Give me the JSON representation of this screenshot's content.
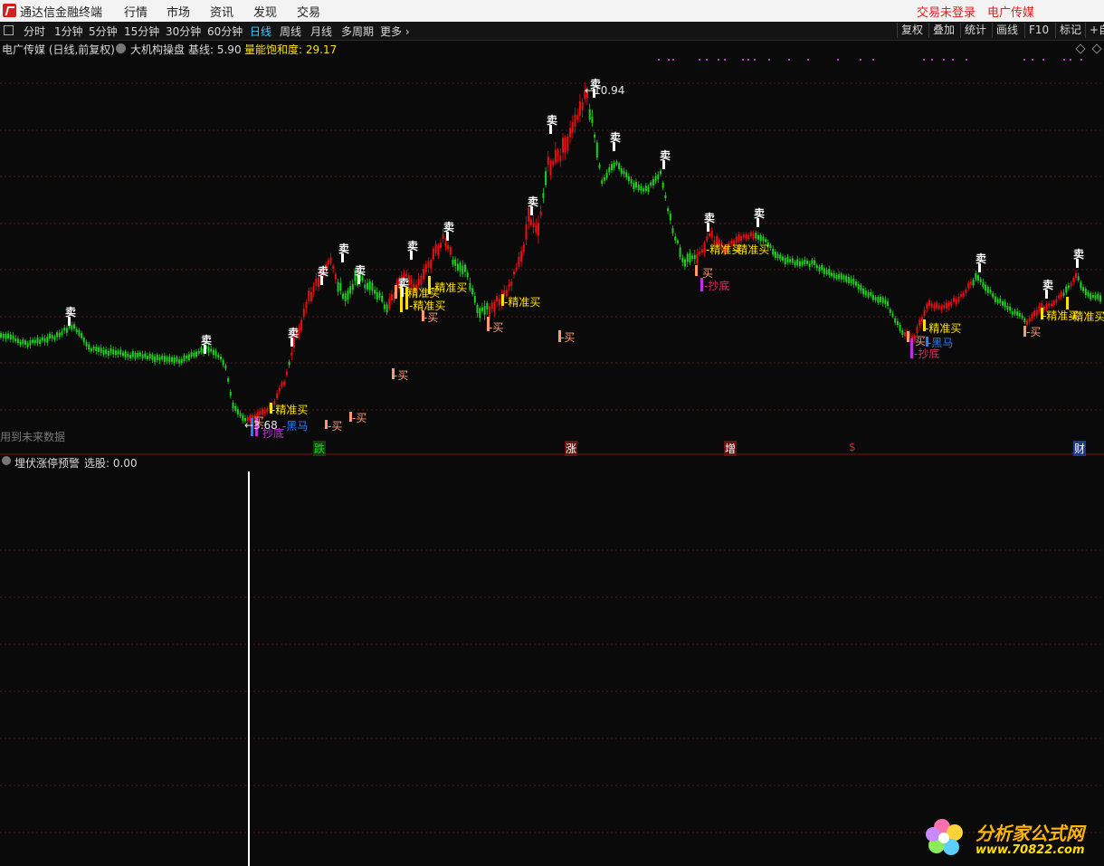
{
  "titlebar": {
    "app_name": "通达信金融终端",
    "menus": [
      "行情",
      "市场",
      "资讯",
      "发现",
      "交易"
    ],
    "login_status": "交易未登录",
    "stock_name": "电广传媒"
  },
  "toolbar": {
    "periods": [
      "分时",
      "1分钟",
      "5分钟",
      "15分钟",
      "30分钟",
      "60分钟",
      "日线",
      "周线",
      "月线",
      "多周期",
      "更多 ›"
    ],
    "active_period": "日线",
    "right_buttons": [
      "复权",
      "叠加",
      "统计",
      "画线",
      "F10",
      "标记",
      "+自"
    ]
  },
  "main_chart": {
    "title": "电广传媒 (日线,前复权)",
    "indicator_name": "大机构操盘",
    "baseline_label": "基线: 5.90",
    "saturation_label": "量能饱和度: 29.17",
    "high_price": "10.94",
    "low_price": "3.68",
    "footnote": "用到未来数据",
    "colors": {
      "up": "#e81010",
      "down": "#1ecf1e",
      "buy_precise": "#ffe000",
      "buy": "#ff9a70",
      "dark_horse": "#2a7bff",
      "bottom": "#c030e0",
      "sell": "#ffffff"
    },
    "sell_marks": [
      "卖",
      "卖",
      "卖",
      "卖",
      "卖",
      "卖",
      "卖",
      "卖",
      "卖",
      "卖",
      "卖",
      "卖",
      "卖",
      "卖",
      "卖",
      "卖",
      "卖",
      "卖",
      "卖"
    ],
    "signals": {
      "precise_buy": "-精准买",
      "buy": "-买",
      "buy_plain": "买",
      "dark_horse": "-黑马",
      "bottom_fishing": "-抄底",
      "bottom_plain": "抄底"
    },
    "events": [
      "跌",
      "涨",
      "增",
      "$",
      "财"
    ]
  },
  "sub_chart": {
    "indicator_name": "埋伏涨停预警",
    "selection_label": "选股: 0.00"
  },
  "watermark": {
    "title": "分析家公式网",
    "url": "www.70822.com"
  }
}
